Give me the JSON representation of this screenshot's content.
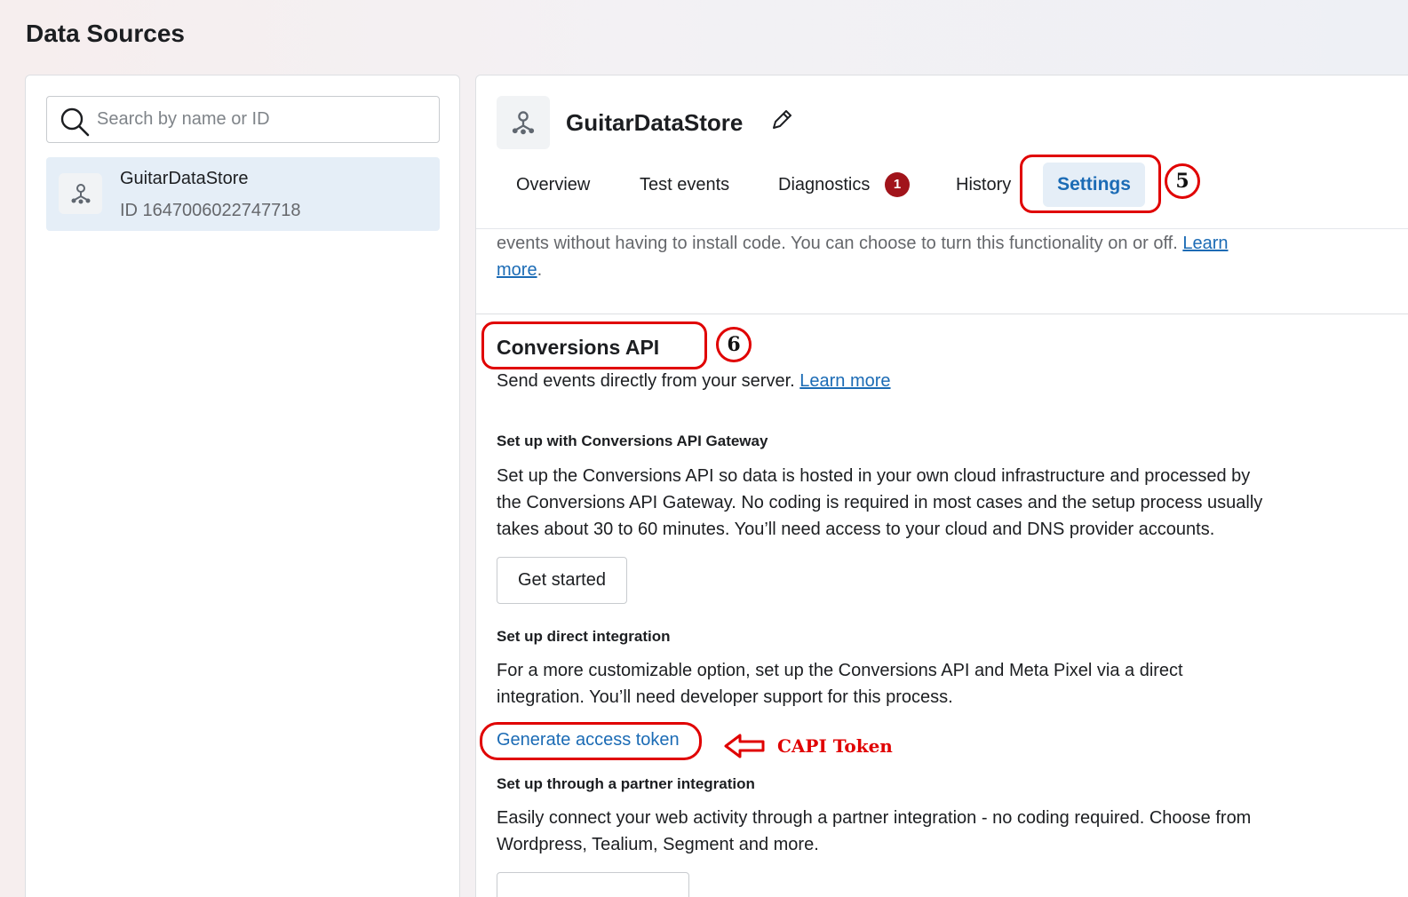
{
  "page": {
    "title": "Data Sources"
  },
  "search": {
    "placeholder": "Search by name or ID"
  },
  "sources": [
    {
      "name": "GuitarDataStore",
      "id_text": "ID 1647006022747718"
    }
  ],
  "detail": {
    "title": "GuitarDataStore",
    "tabs": [
      "Overview",
      "Test events",
      "Diagnostics",
      "History",
      "Settings"
    ],
    "active_tab": "Settings",
    "diagnostics_badge": "1",
    "intro_text": "events without having to install code. You can choose to turn this functionality on or off.",
    "intro_link_1": "Learn",
    "intro_link_2": "more",
    "intro_period": ".",
    "capi": {
      "heading": "Conversions API",
      "description": "Send events directly from your server.",
      "learn_more": "Learn more",
      "gateway": {
        "heading": "Set up with Conversions API Gateway",
        "line1": "Set up the Conversions API so data is hosted in your own cloud infrastructure and processed by",
        "line2": "the Conversions API Gateway. No coding is required in most cases and the setup process usually",
        "line3": "takes about 30 to 60 minutes. You’ll need access to your cloud and DNS provider accounts.",
        "button": "Get started"
      },
      "direct": {
        "heading": "Set up direct integration",
        "line1": "For a more customizable option, set up the Conversions API and Meta Pixel via a direct",
        "line2": "integration. You’ll need developer support for this process.",
        "link": "Generate access token"
      },
      "partner": {
        "heading": "Set up through a partner integration",
        "line1": "Easily connect your web activity through a partner integration - no coding required. Choose from",
        "line2": "Wordpress, Tealium, Segment and more."
      }
    }
  },
  "annotations": {
    "step5": "5",
    "step6": "6",
    "capi_label": "CAPI Token",
    "color": "#e00000"
  },
  "colors": {
    "accent": "#1b6bb5",
    "selected_bg": "#e5eef7",
    "badge": "#a1141b"
  }
}
